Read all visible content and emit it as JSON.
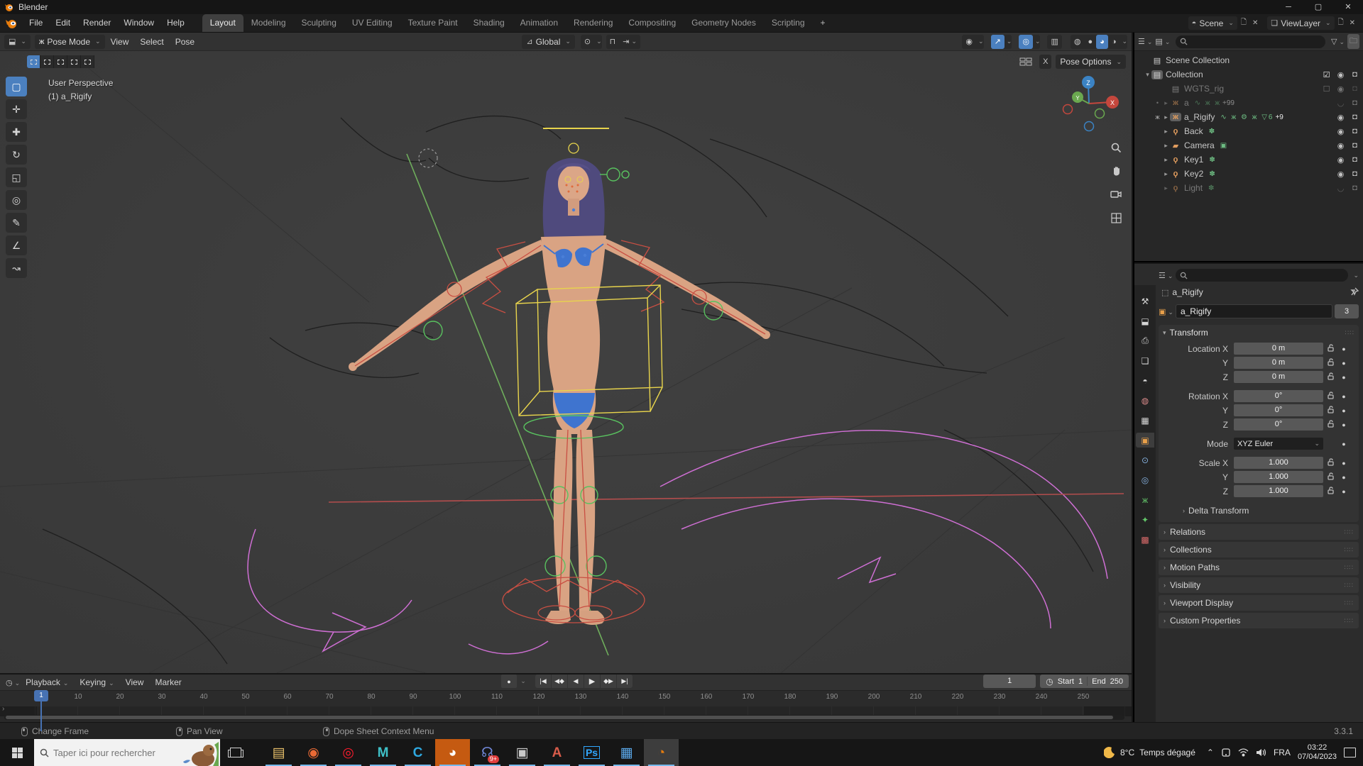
{
  "window": {
    "title": "Blender",
    "minimize": "─",
    "maximize": "▢",
    "close": "✕"
  },
  "topbar": {
    "menus": [
      {
        "label": "File"
      },
      {
        "label": "Edit"
      },
      {
        "label": "Render"
      },
      {
        "label": "Window"
      },
      {
        "label": "Help"
      }
    ],
    "workspaces": [
      {
        "label": "Layout",
        "active": "true"
      },
      {
        "label": "Modeling"
      },
      {
        "label": "Sculpting"
      },
      {
        "label": "UV Editing"
      },
      {
        "label": "Texture Paint"
      },
      {
        "label": "Shading"
      },
      {
        "label": "Animation"
      },
      {
        "label": "Rendering"
      },
      {
        "label": "Compositing"
      },
      {
        "label": "Geometry Nodes"
      },
      {
        "label": "Scripting"
      },
      {
        "label": "+",
        "add": "true"
      }
    ],
    "scene_label": "Scene",
    "view_layer_label": "ViewLayer"
  },
  "viewport": {
    "mode_label": "Pose Mode",
    "menus": [
      {
        "label": "View"
      },
      {
        "label": "Select"
      },
      {
        "label": "Pose"
      }
    ],
    "orientation_label": "Global",
    "mirror_x_label": "X",
    "pose_options_label": "Pose Options",
    "info_line1": "User Perspective",
    "info_line2": "(1) a_Rigify",
    "gizmo": {
      "x": "X",
      "y": "Y",
      "z": "Z"
    },
    "tools": [
      {
        "name": "select-box",
        "glyph": "▢",
        "active": "true"
      },
      {
        "name": "cursor",
        "glyph": "✛"
      },
      {
        "name": "move",
        "glyph": "✚"
      },
      {
        "name": "rotate",
        "glyph": "↻"
      },
      {
        "name": "scale",
        "glyph": "◱"
      },
      {
        "name": "transform",
        "glyph": "◎"
      },
      {
        "name": "annotate",
        "glyph": "✎"
      },
      {
        "name": "measure",
        "glyph": "∠"
      },
      {
        "name": "pose-breakdowner",
        "glyph": "↝"
      }
    ]
  },
  "outliner": {
    "rows": [
      {
        "label": "Scene Collection",
        "icon": "collection",
        "gutter": "",
        "arrow": "",
        "extras": "",
        "badge": "",
        "check": "",
        "eye": "",
        "cam": ""
      },
      {
        "label": "Collection",
        "icon": "collection",
        "gutter": "",
        "arrow": "▾",
        "boxed": "true",
        "extras": "",
        "badge": "",
        "check": "checked",
        "eye": "open",
        "cam": "on"
      },
      {
        "label": "WGTS_rig",
        "icon": "collection",
        "gutter": "",
        "arrow": "",
        "dim": "true",
        "pad": "true",
        "extras": "",
        "badge": "",
        "check": "unchecked",
        "eye": "open",
        "cam": "off"
      },
      {
        "label": "a",
        "icon": "armature",
        "gutter": "•",
        "arrow": "▸",
        "dim": "true",
        "pad": "true",
        "extras": "∿ ж ж",
        "badge": "+99",
        "check": "",
        "eye": "closed",
        "cam": "on"
      },
      {
        "label": "a_Rigify",
        "icon": "armature",
        "gutter": "ж",
        "arrow": "▸",
        "boxed": "true",
        "pad": "true",
        "extras": "∿ ж ⚙ ж ▽6",
        "badge": "+9",
        "check": "",
        "eye": "open",
        "cam": "on"
      },
      {
        "label": "Back",
        "icon": "light",
        "gutter": "",
        "arrow": "▸",
        "pad": "true",
        "extras": "✽",
        "badge": "",
        "check": "",
        "eye": "open",
        "cam": "on"
      },
      {
        "label": "Camera",
        "icon": "camera",
        "gutter": "",
        "arrow": "▸",
        "pad": "true",
        "extras": "▣",
        "badge": "",
        "check": "",
        "eye": "open",
        "cam": "on"
      },
      {
        "label": "Key1",
        "icon": "light",
        "gutter": "",
        "arrow": "▸",
        "pad": "true",
        "extras": "✽",
        "badge": "",
        "check": "",
        "eye": "open",
        "cam": "on"
      },
      {
        "label": "Key2",
        "icon": "light",
        "gutter": "",
        "arrow": "▸",
        "pad": "true",
        "extras": "✽",
        "badge": "",
        "check": "",
        "eye": "open",
        "cam": "on"
      },
      {
        "label": "Light",
        "icon": "light",
        "gutter": "",
        "arrow": "▸",
        "dim": "true",
        "pad": "true",
        "extras": "✽",
        "badge": "",
        "check": "",
        "eye": "closed",
        "cam": "on"
      }
    ]
  },
  "properties": {
    "breadcrumb": "a_Rigify",
    "name_value": "a_Rigify",
    "users_count": "3",
    "transform_title": "Transform",
    "location_rows": [
      {
        "label": "Location X",
        "value": "0 m"
      },
      {
        "label": "Y",
        "value": "0 m"
      },
      {
        "label": "Z",
        "value": "0 m"
      }
    ],
    "rotation_rows": [
      {
        "label": "Rotation X",
        "value": "0°"
      },
      {
        "label": "Y",
        "value": "0°"
      },
      {
        "label": "Z",
        "value": "0°"
      }
    ],
    "mode_label": "Mode",
    "mode_value": "XYZ Euler",
    "scale_rows": [
      {
        "label": "Scale X",
        "value": "1.000"
      },
      {
        "label": "Y",
        "value": "1.000"
      },
      {
        "label": "Z",
        "value": "1.000"
      }
    ],
    "subpanel_label": "Delta Transform",
    "panels": [
      {
        "label": "Relations"
      },
      {
        "label": "Collections"
      },
      {
        "label": "Motion Paths"
      },
      {
        "label": "Visibility"
      },
      {
        "label": "Viewport Display"
      },
      {
        "label": "Custom Properties"
      }
    ],
    "tabs": [
      {
        "name": "tool",
        "glyph": "⚒",
        "style": "color:#d5d5d5"
      },
      {
        "name": "render",
        "glyph": "⬓",
        "style": "color:#d5d5d5"
      },
      {
        "name": "output",
        "glyph": "⎙",
        "style": "color:#d5d5d5"
      },
      {
        "name": "view-layer",
        "glyph": "❏",
        "style": "color:#d5d5d5"
      },
      {
        "name": "scene",
        "glyph": "◓",
        "style": "color:#d5d5d5"
      },
      {
        "name": "world",
        "glyph": "◍",
        "style": "color:#d98a8a"
      },
      {
        "name": "collection",
        "glyph": "▦",
        "style": "color:#d5d5d5"
      },
      {
        "name": "object",
        "glyph": "▣",
        "style": "color:#e8a04a",
        "active": "true"
      },
      {
        "name": "constraints",
        "glyph": "⊙",
        "style": "color:#86b2e0"
      },
      {
        "name": "physics",
        "glyph": "◎",
        "style": "color:#86b2e0"
      },
      {
        "name": "object-data",
        "glyph": "ж",
        "style": "color:#63c76a"
      },
      {
        "name": "bone",
        "glyph": "✦",
        "style": "color:#63c76a"
      },
      {
        "name": "texture",
        "glyph": "▩",
        "style": "color:#d96a6a"
      }
    ]
  },
  "timeline": {
    "menus": [
      {
        "label": "Playback",
        "caret": "true"
      },
      {
        "label": "Keying",
        "caret": "true"
      },
      {
        "label": "View"
      },
      {
        "label": "Marker"
      }
    ],
    "current_frame": "1",
    "start_label": "Start",
    "start_value": "1",
    "end_label": "End",
    "end_value": "250",
    "ruler": [
      {
        "n": "10",
        "style": "left:98px"
      },
      {
        "n": "20",
        "style": "left:157px"
      },
      {
        "n": "30",
        "style": "left:216px"
      },
      {
        "n": "40",
        "style": "left:275px"
      },
      {
        "n": "50",
        "style": "left:334px"
      },
      {
        "n": "60",
        "style": "left:393px"
      },
      {
        "n": "70",
        "style": "left:452px"
      },
      {
        "n": "80",
        "style": "left:511px"
      },
      {
        "n": "90",
        "style": "left:570px"
      },
      {
        "n": "100",
        "style": "left:629px"
      },
      {
        "n": "110",
        "style": "left:688px"
      },
      {
        "n": "120",
        "style": "left:747px"
      },
      {
        "n": "130",
        "style": "left:806px"
      },
      {
        "n": "140",
        "style": "left:865px"
      },
      {
        "n": "150",
        "style": "left:924px"
      },
      {
        "n": "160",
        "style": "left:983px"
      },
      {
        "n": "170",
        "style": "left:1042px"
      },
      {
        "n": "180",
        "style": "left:1101px"
      },
      {
        "n": "190",
        "style": "left:1160px"
      },
      {
        "n": "200",
        "style": "left:1219px"
      },
      {
        "n": "210",
        "style": "left:1278px"
      },
      {
        "n": "220",
        "style": "left:1337px"
      },
      {
        "n": "230",
        "style": "left:1396px"
      },
      {
        "n": "240",
        "style": "left:1455px"
      },
      {
        "n": "250",
        "style": "left:1514px"
      }
    ]
  },
  "statusbar": {
    "hints": [
      {
        "label": "Change Frame",
        "button": "left",
        "style": "left:30px"
      },
      {
        "label": "Pan View",
        "button": "middle",
        "style": "left:248px"
      },
      {
        "label": "Dope Sheet Context Menu",
        "button": "right",
        "style": "left:455px"
      }
    ],
    "version": "3.3.1"
  },
  "taskbar": {
    "search_placeholder": "Taper ici pour rechercher",
    "apps": [
      {
        "name": "file-explorer",
        "glyph": "▤",
        "style": "color:#e8c06a",
        "underline": "true",
        "badge": ""
      },
      {
        "name": "chrome",
        "glyph": "◉",
        "style": "color:#ea6a35",
        "underline": "true",
        "badge": ""
      },
      {
        "name": "opera",
        "glyph": "◎",
        "style": "color:#ff1b2d",
        "underline": "true",
        "badge": ""
      },
      {
        "name": "maya",
        "glyph": "M",
        "style": "color:#3fc1c9",
        "underline": "true",
        "badge": ""
      },
      {
        "name": "cyberlink",
        "glyph": "C",
        "style": "color:#2ea8e0",
        "underline": "true",
        "badge": ""
      },
      {
        "name": "camtasia",
        "glyph": "◕",
        "style": "color:#ffffff",
        "btn_style": "background:#c55a11",
        "underline": "true",
        "badge": ""
      },
      {
        "name": "discord",
        "glyph": "☊",
        "style": "color:#7289da",
        "underline": "true",
        "badge": "9+"
      },
      {
        "name": "system-app",
        "glyph": "▣",
        "style": "color:#c9c9c9",
        "underline": "true",
        "badge": ""
      },
      {
        "name": "access",
        "glyph": "A",
        "style": "color:#d85c4a",
        "underline": "true",
        "badge": ""
      },
      {
        "name": "photoshop",
        "glyph": "Ps",
        "style": "color:#31a8ff;font-size:14px;border:1px solid #31a8ff;padding:1px 2px",
        "underline": "true",
        "badge": ""
      },
      {
        "name": "photos",
        "glyph": "▦",
        "style": "color:#5aa7e8",
        "underline": "true",
        "badge": ""
      },
      {
        "name": "blender",
        "glyph": "◔",
        "style": "color:#e87d0d",
        "btn_style": "background:#3d3d3d",
        "underline": "true",
        "badge": ""
      }
    ],
    "tray": {
      "temperature": "8°C",
      "condition": "Temps dégagé",
      "language": "FRA",
      "time": "03:22",
      "date": "07/04/2023"
    }
  }
}
